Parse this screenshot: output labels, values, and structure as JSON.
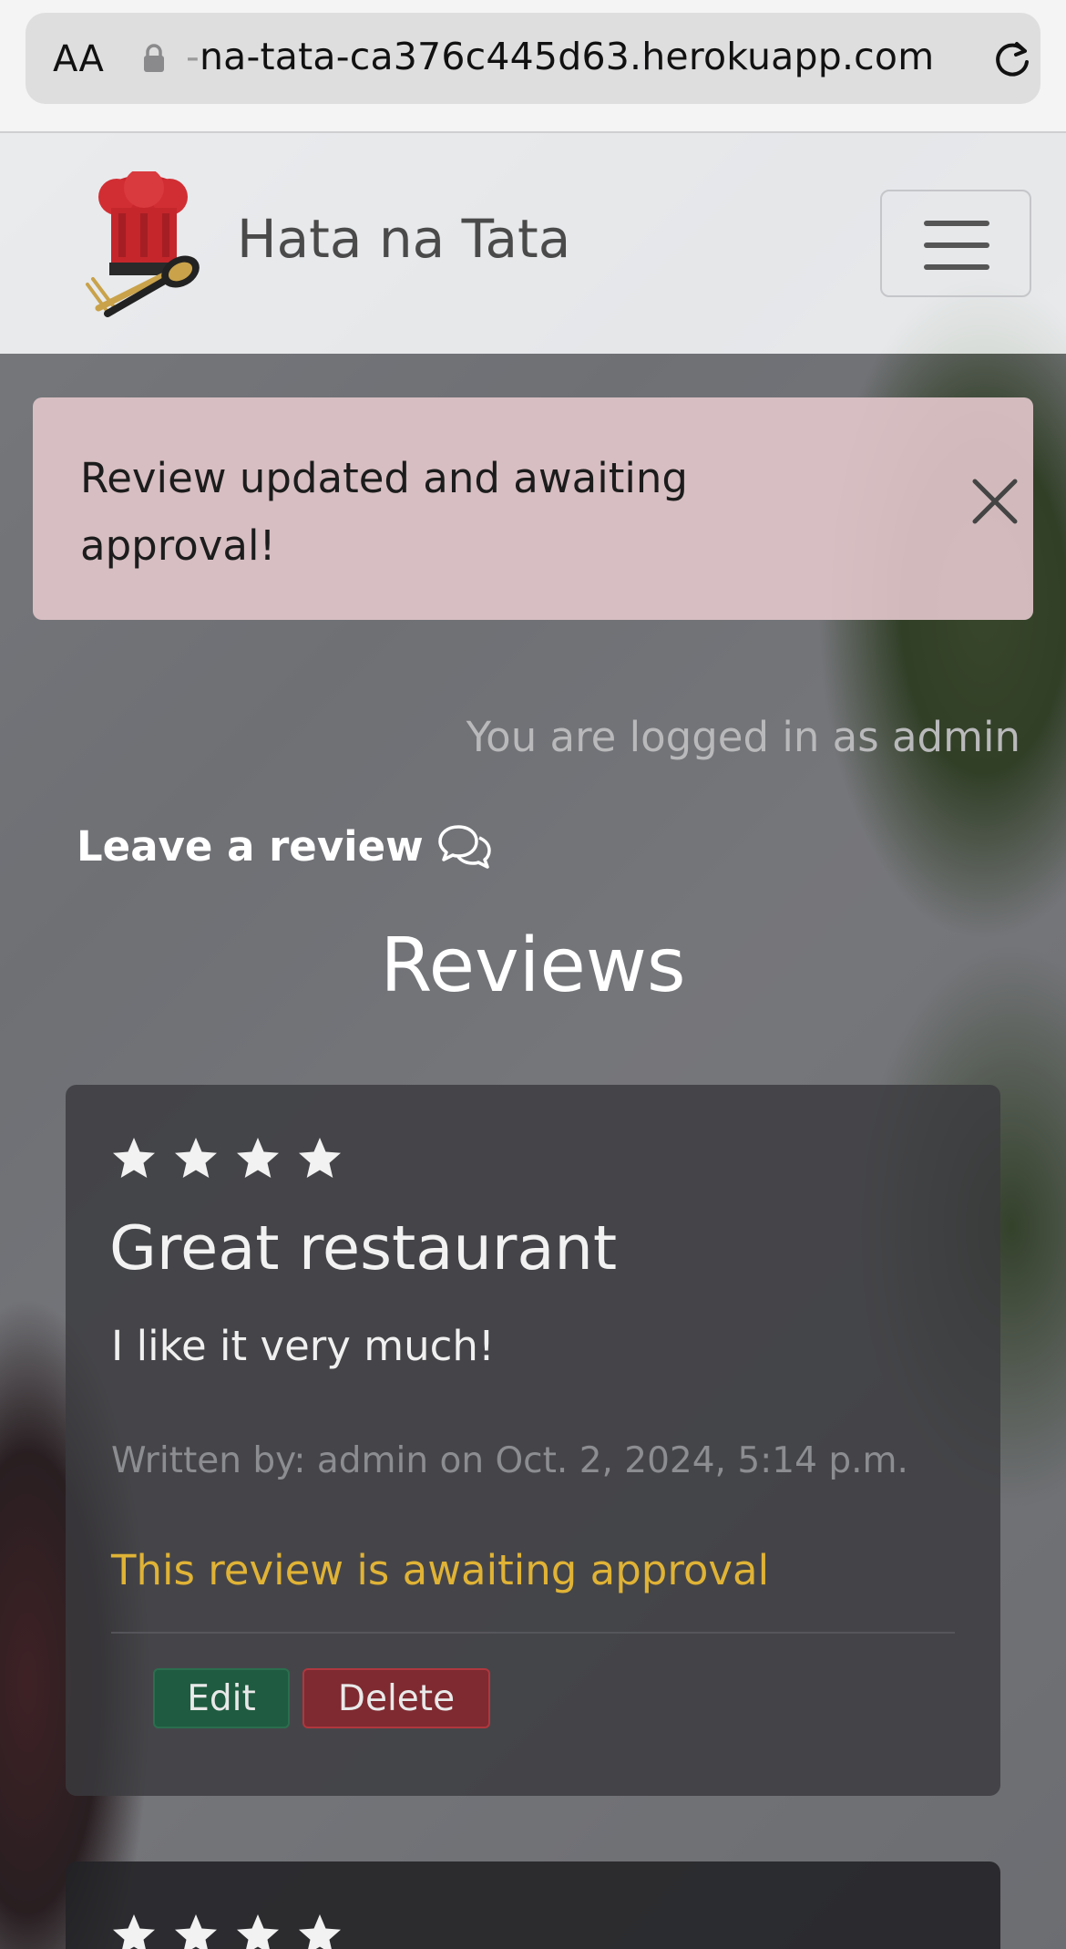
{
  "browser": {
    "text_size_label": "AA",
    "url_prefix": "-",
    "url": "na-tata-ca376c445d63.herokuapp.com"
  },
  "navbar": {
    "brand": "Hata na Tata"
  },
  "alert": {
    "message": "Review updated and awaiting approval!"
  },
  "login_note": "You are logged in as admin",
  "leave_review_label": "Leave a review",
  "reviews_heading": "Reviews",
  "reviews": [
    {
      "rating": 4,
      "title": "Great restaurant",
      "body": "I like it very much!",
      "meta": "Written by: admin on Oct. 2, 2024, 5:14 p.m.",
      "pending_note": "This review is awaiting approval",
      "edit_label": "Edit",
      "delete_label": "Delete"
    },
    {
      "rating": 4
    }
  ],
  "colors": {
    "pending": "#e0b336",
    "edit_button": "#1f5b40",
    "delete_button": "#7e2a30",
    "alert_bg": "#dfc4c8"
  }
}
